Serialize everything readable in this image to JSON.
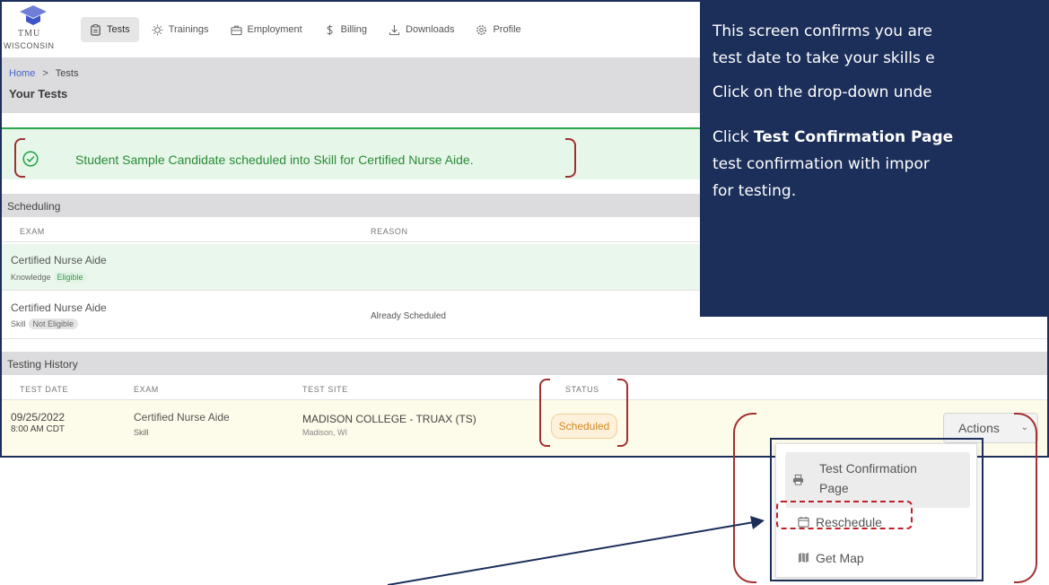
{
  "logo": {
    "line1": "TMU",
    "line2": "WISCONSIN"
  },
  "nav": [
    {
      "label": "Tests",
      "icon": "clipboard-icon",
      "active": true
    },
    {
      "label": "Trainings",
      "icon": "lightbulb-icon"
    },
    {
      "label": "Employment",
      "icon": "briefcase-icon"
    },
    {
      "label": "Billing",
      "icon": "dollar-icon"
    },
    {
      "label": "Downloads",
      "icon": "download-icon"
    },
    {
      "label": "Profile",
      "icon": "gear-icon"
    }
  ],
  "breadcrumb": {
    "home": "Home",
    "separator": ">",
    "current": "Tests"
  },
  "page_title": "Your Tests",
  "alert": {
    "text": "Student Sample Candidate scheduled into Skill for Certified Nurse Aide."
  },
  "scheduling": {
    "title": "Scheduling",
    "columns": {
      "exam": "EXAM",
      "reason": "REASON"
    },
    "rows": [
      {
        "exam": "Certified Nurse Aide",
        "type": "Knowledge",
        "status": "Eligible",
        "reason": ""
      },
      {
        "exam": "Certified Nurse Aide",
        "type": "Skill",
        "status": "Not Eligible",
        "reason": "Already Scheduled"
      }
    ]
  },
  "history": {
    "title": "Testing History",
    "columns": {
      "date": "TEST DATE",
      "exam": "EXAM",
      "site": "TEST SITE",
      "status": "STATUS"
    },
    "row": {
      "date": "09/25/2022",
      "time": "8:00 AM CDT",
      "exam": "Certified Nurse Aide",
      "type": "Skill",
      "site": "MADISON COLLEGE - TRUAX (TS)",
      "city": "Madison, WI",
      "status": "Scheduled",
      "actions": "Actions"
    }
  },
  "callout": {
    "l1": "This screen confirms you are",
    "l2": "test date to take your skills e",
    "l3": "Click on the drop-down unde",
    "l4a": "Click ",
    "l4b": "Test Confirmation Page",
    "l5": "test confirmation with impor",
    "l6": "for testing."
  },
  "menu": {
    "item1a": "Test Confirmation",
    "item1b": "Page",
    "item2": "Reschedule",
    "item3": "Get Map"
  },
  "colors": {
    "navy": "#1c2f5a",
    "success": "#2aa64a",
    "annotation_red": "#a23030",
    "scheduled": "#d28a22"
  }
}
